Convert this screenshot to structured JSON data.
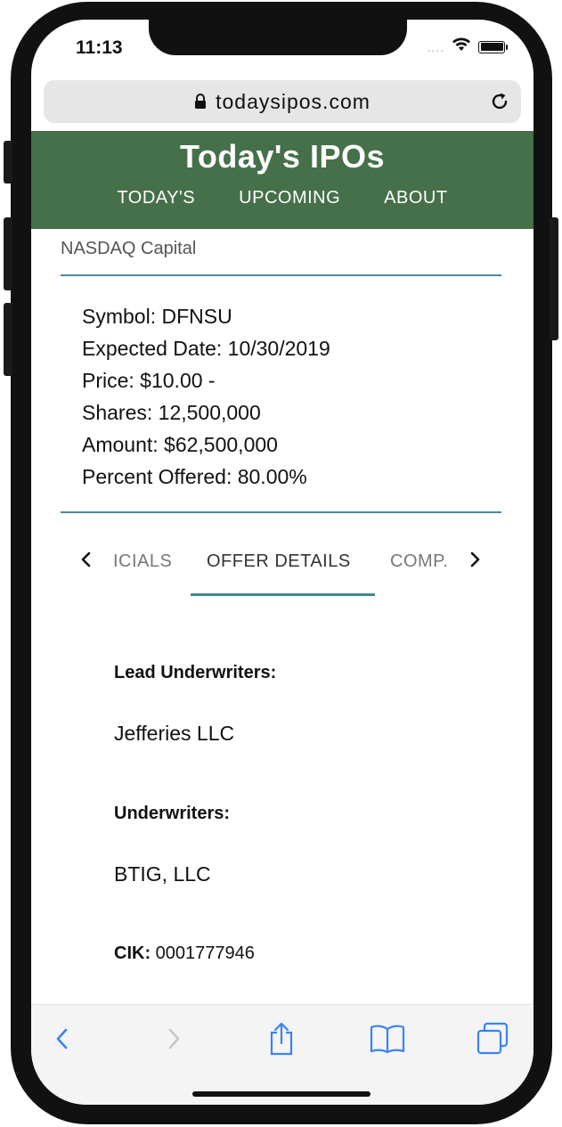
{
  "status_bar": {
    "time": "11:13",
    "signal_dots": "....",
    "icons": [
      "wifi-icon",
      "battery-icon"
    ]
  },
  "browser": {
    "url": "todaysipos.com",
    "lock_icon": "lock-icon",
    "reload_icon": "reload-icon"
  },
  "site": {
    "brand": "Today's IPOs",
    "nav": [
      "TODAY'S",
      "UPCOMING",
      "ABOUT"
    ],
    "brand_color": "#467049"
  },
  "ipo": {
    "exchange": "NASDAQ Capital",
    "lines": [
      "Symbol: DFNSU",
      "Expected Date: 10/30/2019",
      "Price: $10.00 -",
      "Shares: 12,500,000",
      "Amount: $62,500,000",
      "Percent Offered: 80.00%"
    ]
  },
  "tabs": {
    "prev_icon": "chevron-left-icon",
    "next_icon": "chevron-right-icon",
    "items": [
      "ICIALS",
      "OFFER DETAILS",
      "COMP."
    ],
    "active": "OFFER DETAILS",
    "accent_color": "#3f8794"
  },
  "offer_details": {
    "lead_underwriters_label": "Lead Underwriters:",
    "lead_underwriters_value": "Jefferies LLC",
    "underwriters_label": "Underwriters:",
    "underwriters_value": "BTIG, LLC",
    "cik_label": "CIK:",
    "cik_value": "0001777946"
  },
  "toolbar": {
    "icons": [
      "back-icon",
      "forward-icon",
      "share-icon",
      "bookmarks-icon",
      "tabs-icon"
    ]
  }
}
